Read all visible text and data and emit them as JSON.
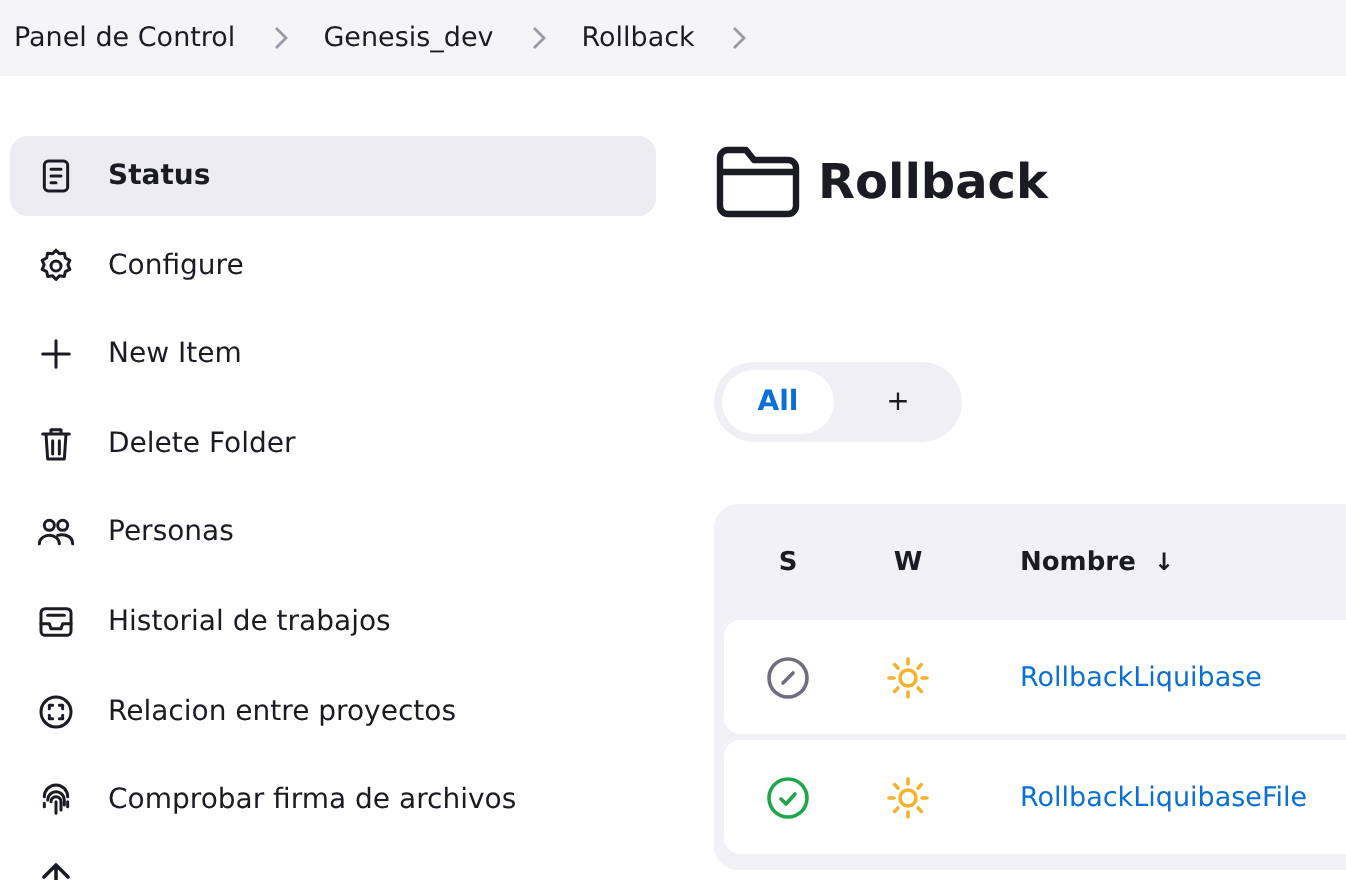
{
  "breadcrumbs": [
    {
      "label": "Panel de Control"
    },
    {
      "label": "Genesis_dev"
    },
    {
      "label": "Rollback"
    }
  ],
  "sidebar": {
    "items": [
      {
        "label": "Status",
        "selected": true
      },
      {
        "label": "Configure",
        "selected": false
      },
      {
        "label": "New Item",
        "selected": false
      },
      {
        "label": "Delete Folder",
        "selected": false
      },
      {
        "label": "Personas",
        "selected": false
      },
      {
        "label": "Historial de trabajos",
        "selected": false
      },
      {
        "label": "Relacion entre proyectos",
        "selected": false
      },
      {
        "label": "Comprobar firma de archivos",
        "selected": false
      },
      {
        "selected": false
      }
    ]
  },
  "page": {
    "title": "Rollback"
  },
  "tabs": [
    {
      "label": "All",
      "selected": true
    },
    {
      "label": "+",
      "selected": false
    }
  ],
  "table": {
    "columns": [
      {
        "label": "S"
      },
      {
        "label": "W"
      },
      {
        "label": "Nombre",
        "sort": "↓"
      }
    ],
    "rows": [
      {
        "kind": "disabled",
        "name": "RollbackLiquibase"
      },
      {
        "kind": "success",
        "name": "RollbackLiquibaseFile"
      }
    ]
  }
}
